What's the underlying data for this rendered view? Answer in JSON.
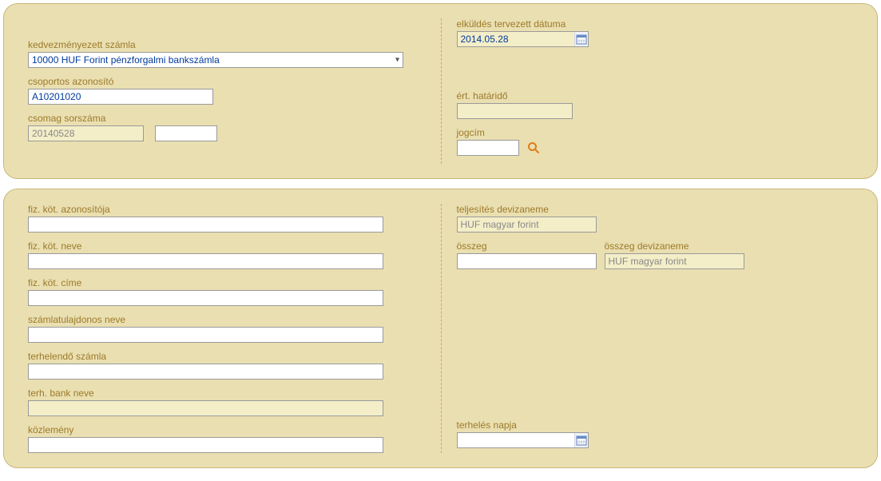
{
  "panel1": {
    "left": {
      "account": {
        "label": "kedvezményezett számla",
        "value": "10000 HUF Forint pénzforgalmi bankszámla"
      },
      "groupId": {
        "label": "csoportos azonosító",
        "value": "A10201020"
      },
      "packageSeq": {
        "label": "csomag sorszáma",
        "value1": "20140528",
        "value2": ""
      }
    },
    "right": {
      "plannedDate": {
        "label": "elküldés tervezett dátuma",
        "value": "2014.05.28"
      },
      "deadline": {
        "label": "ért. határidő",
        "value": ""
      },
      "title": {
        "label": "jogcím",
        "value": ""
      }
    }
  },
  "panel2": {
    "left": {
      "payerId": {
        "label": "fiz. köt. azonosítója",
        "value": ""
      },
      "payerName": {
        "label": "fiz. köt. neve",
        "value": ""
      },
      "payerAddr": {
        "label": "fiz. köt. címe",
        "value": ""
      },
      "ownerName": {
        "label": "számlatulajdonos neve",
        "value": ""
      },
      "debitAcct": {
        "label": "terhelendő számla",
        "value": ""
      },
      "debitBank": {
        "label": "terh. bank neve",
        "value": ""
      },
      "memo": {
        "label": "közlemény",
        "value": ""
      }
    },
    "right": {
      "perfCurrency": {
        "label": "teljesítés devizaneme",
        "value": "HUF magyar forint"
      },
      "amount": {
        "label": "összeg",
        "value": ""
      },
      "amountCurrency": {
        "label": "összeg devizaneme",
        "value": "HUF magyar forint"
      },
      "debitDate": {
        "label": "terhelés napja",
        "value": ""
      }
    }
  }
}
